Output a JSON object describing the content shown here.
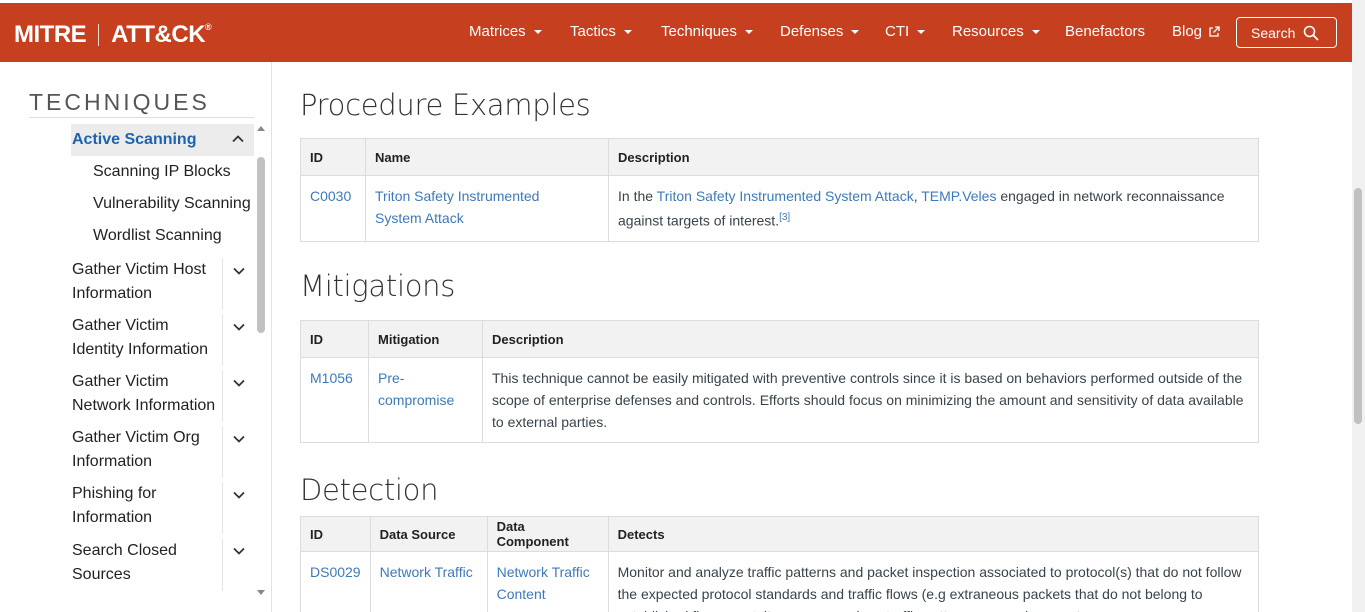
{
  "brand": {
    "mitre": "MITRE",
    "attack": "ATT&CK",
    "reg": "®"
  },
  "nav": {
    "items": [
      {
        "label": "Matrices",
        "dropdown": true
      },
      {
        "label": "Tactics",
        "dropdown": true
      },
      {
        "label": "Techniques",
        "dropdown": true
      },
      {
        "label": "Defenses",
        "dropdown": true
      },
      {
        "label": "CTI",
        "dropdown": true
      },
      {
        "label": "Resources",
        "dropdown": true
      },
      {
        "label": "Benefactors",
        "dropdown": false
      },
      {
        "label": "Blog",
        "dropdown": false,
        "external": true
      }
    ],
    "search_label": "Search"
  },
  "sidebar": {
    "title": "TECHNIQUES",
    "active": "Active Scanning",
    "subitems": [
      "Scanning IP Blocks",
      "Vulnerability Scanning",
      "Wordlist Scanning"
    ],
    "items": [
      {
        "line1": "Gather Victim Host",
        "line2": "Information"
      },
      {
        "line1": "Gather Victim",
        "line2": "Identity Information"
      },
      {
        "line1": "Gather Victim",
        "line2": "Network Information"
      },
      {
        "line1": "Gather Victim Org",
        "line2": "Information"
      },
      {
        "line1": "Phishing for",
        "line2": "Information"
      },
      {
        "line1": "Search Closed",
        "line2": "Sources"
      }
    ]
  },
  "procedures": {
    "title": "Procedure Examples",
    "headers": [
      "ID",
      "Name",
      "Description"
    ],
    "rows": [
      {
        "id": "C0030",
        "name_line1": "Triton Safety Instrumented",
        "name_line2": "System Attack",
        "desc_prefix": "In the ",
        "desc_link1": "Triton Safety Instrumented System Attack",
        "desc_sep": ", ",
        "desc_link2": "TEMP.Veles",
        "desc_suffix": " engaged in network reconnaissance against targets of interest.",
        "ref": "[3]"
      }
    ]
  },
  "mitigations": {
    "title": "Mitigations",
    "headers": [
      "ID",
      "Mitigation",
      "Description"
    ],
    "rows": [
      {
        "id": "M1056",
        "name_line1": "Pre-",
        "name_line2": "compromise",
        "desc": "This technique cannot be easily mitigated with preventive controls since it is based on behaviors performed outside of the scope of enterprise defenses and controls. Efforts should focus on minimizing the amount and sensitivity of data available to external parties."
      }
    ]
  },
  "detection": {
    "title": "Detection",
    "headers": [
      "ID",
      "Data Source",
      "Data Component",
      "Detects"
    ],
    "rows": [
      {
        "id": "DS0029",
        "source": "Network Traffic",
        "component_line1": "Network Traffic",
        "component_line2": "Content",
        "detects": "Monitor and analyze traffic patterns and packet inspection associated to protocol(s) that do not follow the expected protocol standards and traffic flows (e.g extraneous packets that do not belong to established flows, gratuitous or anomalous traffic patterns, anomalous syntax, or"
      }
    ]
  }
}
